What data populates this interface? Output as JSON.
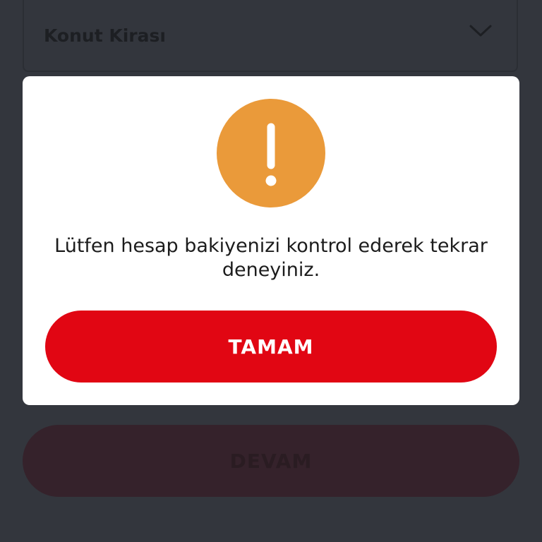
{
  "background_form": {
    "select_value": "Konut Kirası",
    "select_icon": "chevron-down-icon",
    "continue_label": "DEVAM"
  },
  "dialog": {
    "icon": "warning-exclamation-icon",
    "message": "Lütfen hesap bakiyenizi kontrol ederek tekrar deneyiniz.",
    "ok_label": "TAMAM"
  },
  "colors": {
    "overlay_background": "#33363d",
    "warning_icon": "#ea9a3a",
    "primary_button": "#e10613",
    "dialog_background": "#ffffff",
    "disabled_button": "#35222b"
  }
}
